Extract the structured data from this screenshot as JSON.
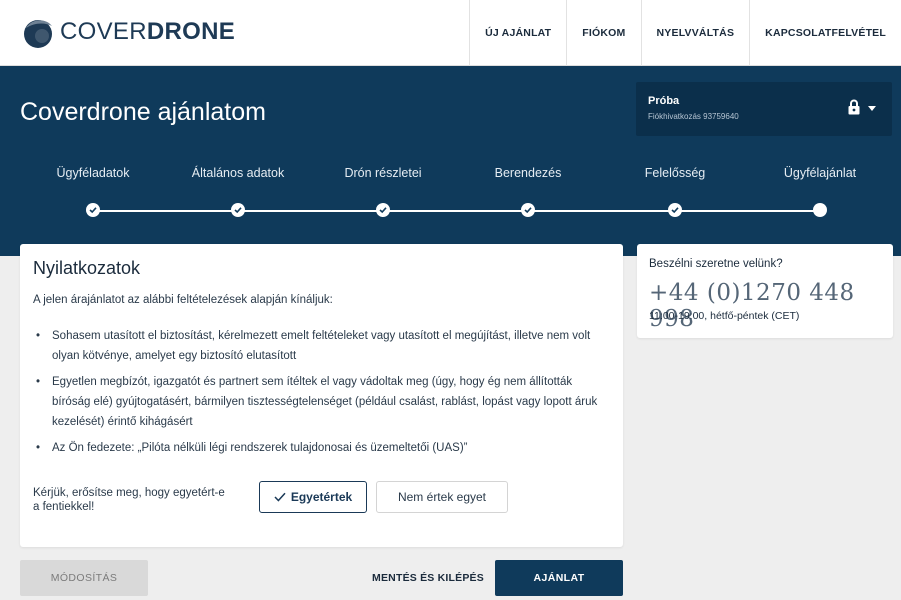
{
  "header": {
    "logo_text_light": "COVER",
    "logo_text_bold": "DRONE",
    "nav": [
      {
        "label": "ÚJ AJÁNLAT"
      },
      {
        "label": "FIÓKOM"
      },
      {
        "label": "NYELVVÁLTÁS"
      },
      {
        "label": "KAPCSOLATFELVÉTEL"
      }
    ]
  },
  "hero": {
    "title": "Coverdrone ajánlatom",
    "account": {
      "name": "Próba",
      "subtitle": "Fiókhivatkozás 93759640"
    },
    "steps": [
      {
        "label": "Ügyféladatok",
        "state": "done"
      },
      {
        "label": "Általános adatok",
        "state": "done"
      },
      {
        "label": "Drón részletei",
        "state": "done"
      },
      {
        "label": "Berendezés",
        "state": "done"
      },
      {
        "label": "Felelősség",
        "state": "done"
      },
      {
        "label": "Ügyfélajánlat",
        "state": "current"
      }
    ]
  },
  "statements": {
    "title": "Nyilatkozatok",
    "intro": "A jelen árajánlatot az alábbi feltételezések alapján kínáljuk:",
    "items": [
      "Sohasem utasított el biztosítást, kérelmezett emelt feltételeket vagy utasított el megújítást, illetve nem volt olyan kötvénye, amelyet egy biztosító elutasított",
      "Egyetlen megbízót, igazgatót és partnert sem ítéltek el vagy vádoltak meg (úgy, hogy ég nem állították bíróság elé) gyújtogatásért, bármilyen tisztességtelenséget (például csalást, rablást, lopást vagy lopott áruk kezelését) érintő kihágásért",
      "Az Ön fedezete: „Pilóta nélküli légi rendszerek tulajdonosai és üzemeltetői (UAS)”"
    ],
    "confirm_text": "Kérjük, erősítse meg, hogy egyetért-e a fentiekkel!",
    "agree_label": "Egyetértek",
    "disagree_label": "Nem értek egyet"
  },
  "contact": {
    "question": "Beszélni szeretne velünk?",
    "phone": "+44 (0)1270 448 998",
    "hours": "11:00-19:00, hétfő-péntek (CET)"
  },
  "footer": {
    "modify_label": "MÓDOSÍTÁS",
    "save_label": "MENTÉS ÉS KILÉPÉS",
    "offer_label": "AJÁNLAT"
  },
  "colors": {
    "primary": "#0f3a5b",
    "page_bg": "#eeeeee",
    "disabled_bg": "#d9d9d9"
  }
}
